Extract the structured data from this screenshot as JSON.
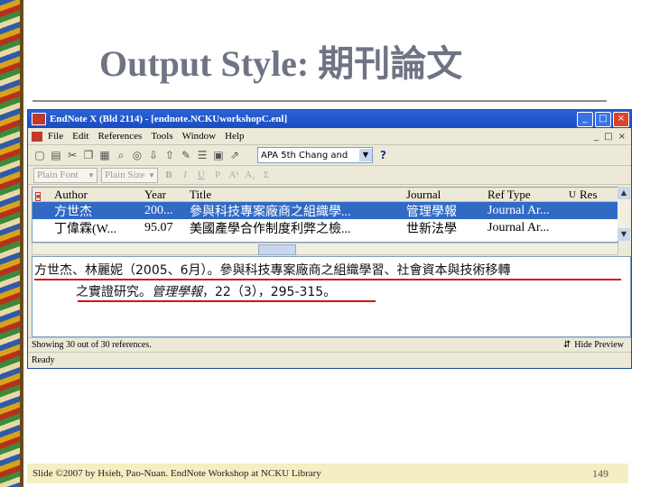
{
  "slide": {
    "title": "Output Style: 期刊論文",
    "footer": "Slide ©2007 by Hsieh, Pao-Nuan. EndNote Workshop at NCKU Library",
    "page_number": "149"
  },
  "window": {
    "title": "EndNote X (Bld 2114) - [endnote.NCKUworkshopC.enl]",
    "controls": [
      "_",
      "□",
      "×"
    ]
  },
  "menu": [
    "File",
    "Edit",
    "References",
    "Tools",
    "Window",
    "Help"
  ],
  "toolbar": {
    "style_value": "APA 5th Chang and",
    "help_label": "?"
  },
  "fontbar": {
    "font": "Plain Font",
    "size": "Plain Size",
    "buttons": [
      "B",
      "I",
      "U",
      "P",
      "A¹",
      "A₁",
      "Σ"
    ]
  },
  "reflist": {
    "columns": [
      "Author",
      "Year",
      "Title",
      "Journal",
      "Ref Type",
      "U",
      "Res"
    ],
    "rows": [
      {
        "author": "方世杰",
        "year": "200...",
        "title": "參與科技專案廠商之組織學...",
        "journal": "管理學報",
        "reftype": "Journal Ar..."
      },
      {
        "author": "丁偉霖(W...",
        "year": "95.07",
        "title": "美國產學合作制度利弊之檢...",
        "journal": "世新法學",
        "reftype": "Journal Ar..."
      }
    ]
  },
  "preview": {
    "line1": "方世杰、林麗妮（2005、6月）。參與科技專案廠商之組織學習、社會資本與技術移轉",
    "line2_plain": "之實證研究。",
    "line2_italic": "管理學報",
    "line2_rest": "，22（3），295-315。"
  },
  "status": {
    "count": "Showing 30 out of 30 references.",
    "hide_preview": "Hide Preview",
    "ready": "Ready"
  },
  "colors": {
    "selection": "#316ac5",
    "underline": "#d21414",
    "titlebar": "#2a63d6",
    "slide_title": "#6f7485",
    "footer_bg": "#f4eec2"
  }
}
